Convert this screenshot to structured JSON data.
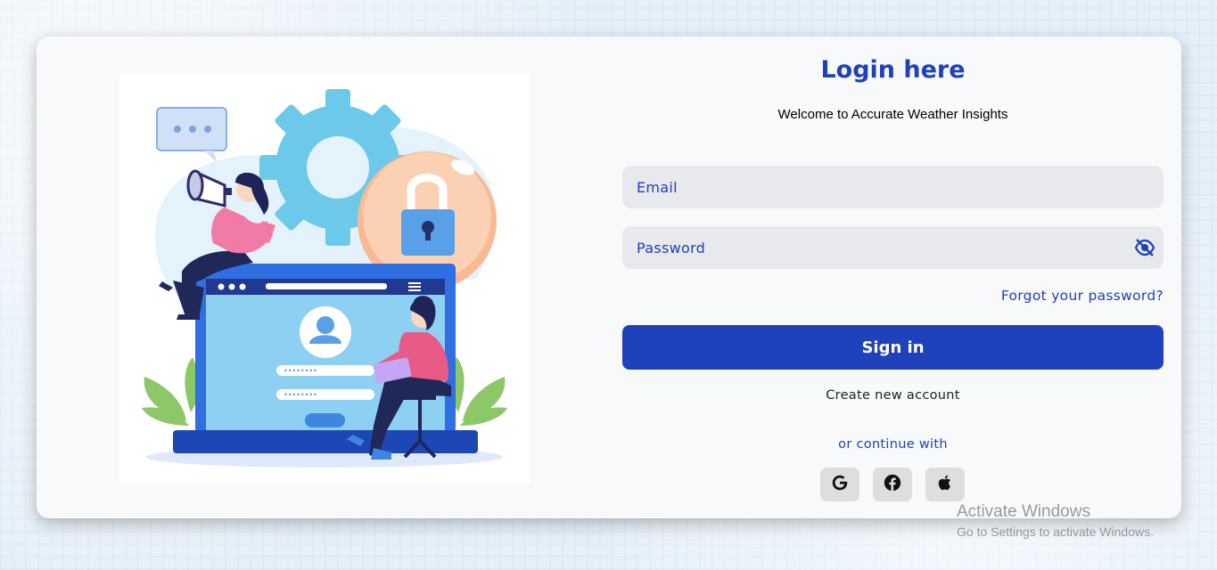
{
  "login": {
    "title": "Login here",
    "subtitle": "Welcome to Accurate Weather Insights",
    "email_placeholder": "Email",
    "password_placeholder": "Password",
    "forgot_password": "Forgot your password?",
    "sign_in": "Sign in",
    "create_account": "Create new account",
    "continue_with": "or continue with",
    "social": [
      {
        "icon": "google-icon"
      },
      {
        "icon": "facebook-icon"
      },
      {
        "icon": "apple-icon"
      }
    ]
  },
  "watermark": {
    "line1": "Activate Windows",
    "line2": "Go to Settings to activate Windows."
  },
  "colors": {
    "accent": "#1f41bb",
    "field_bg": "#e8e9ec",
    "card_bg": "#f8f9fa"
  }
}
